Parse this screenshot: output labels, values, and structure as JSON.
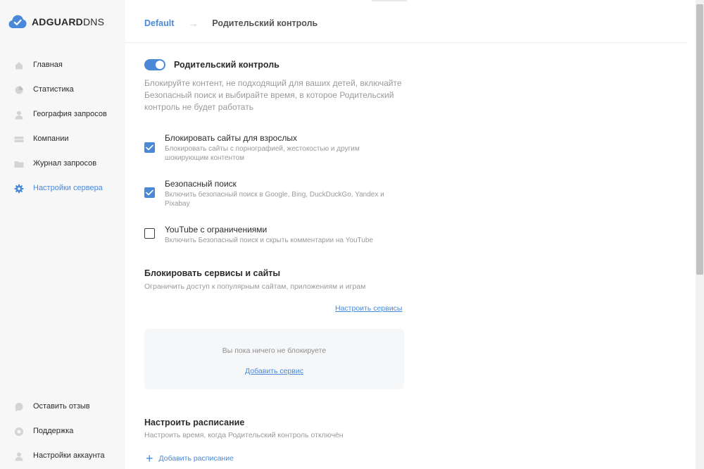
{
  "app": {
    "logo_bold": "ADGUARD",
    "logo_light": "DNS",
    "brand_color": "#4a88d8"
  },
  "sidebar": {
    "items": [
      {
        "label": "Главная",
        "icon": "home-icon"
      },
      {
        "label": "Статистика",
        "icon": "chart-icon"
      },
      {
        "label": "География запросов",
        "icon": "person-icon"
      },
      {
        "label": "Компании",
        "icon": "server-icon"
      },
      {
        "label": "Журнал запросов",
        "icon": "folder-icon"
      },
      {
        "label": "Настройки сервера",
        "icon": "gear-icon",
        "active": true
      }
    ],
    "bottom_items": [
      {
        "label": "Оставить отзыв",
        "icon": "chat-icon"
      },
      {
        "label": "Поддержка",
        "icon": "support-icon"
      },
      {
        "label": "Настройки аккаунта",
        "icon": "person-icon"
      }
    ]
  },
  "breadcrumb": {
    "root": "Default",
    "separator": "→",
    "current": "Родительский контроль"
  },
  "parental": {
    "enabled": true,
    "title": "Родительский контроль",
    "description": "Блокируйте контент, не подходящий для ваших детей, включайте Безопасный поиск и выбирайте время, в которое Родительский контроль не будет работать",
    "options": [
      {
        "title": "Блокировать сайты для взрослых",
        "description": "Блокировать сайты с порнографией, жестокостью и другим шокирующим контентом",
        "checked": true
      },
      {
        "title": "Безопасный поиск",
        "description": "Включить безопасный поиск в Google, Bing, DuckDuckGo, Yandex и Pixabay",
        "checked": true
      },
      {
        "title": "YouTube с ограничениями",
        "description": "Включить Безопасный поиск и скрыть комментарии на YouTube",
        "checked": false
      }
    ]
  },
  "services": {
    "title": "Блокировать сервисы и сайты",
    "description": "Ограничить доступ к популярным сайтам, приложениям и играм",
    "configure_link": "Настроить сервисы",
    "empty_text": "Вы пока ничего не блокируете",
    "add_link": "Добавить сервис"
  },
  "schedule": {
    "title": "Настроить расписание",
    "description": "Настроить время, когда Родительский контроль отключён",
    "add_label": "Добавить расписание"
  }
}
